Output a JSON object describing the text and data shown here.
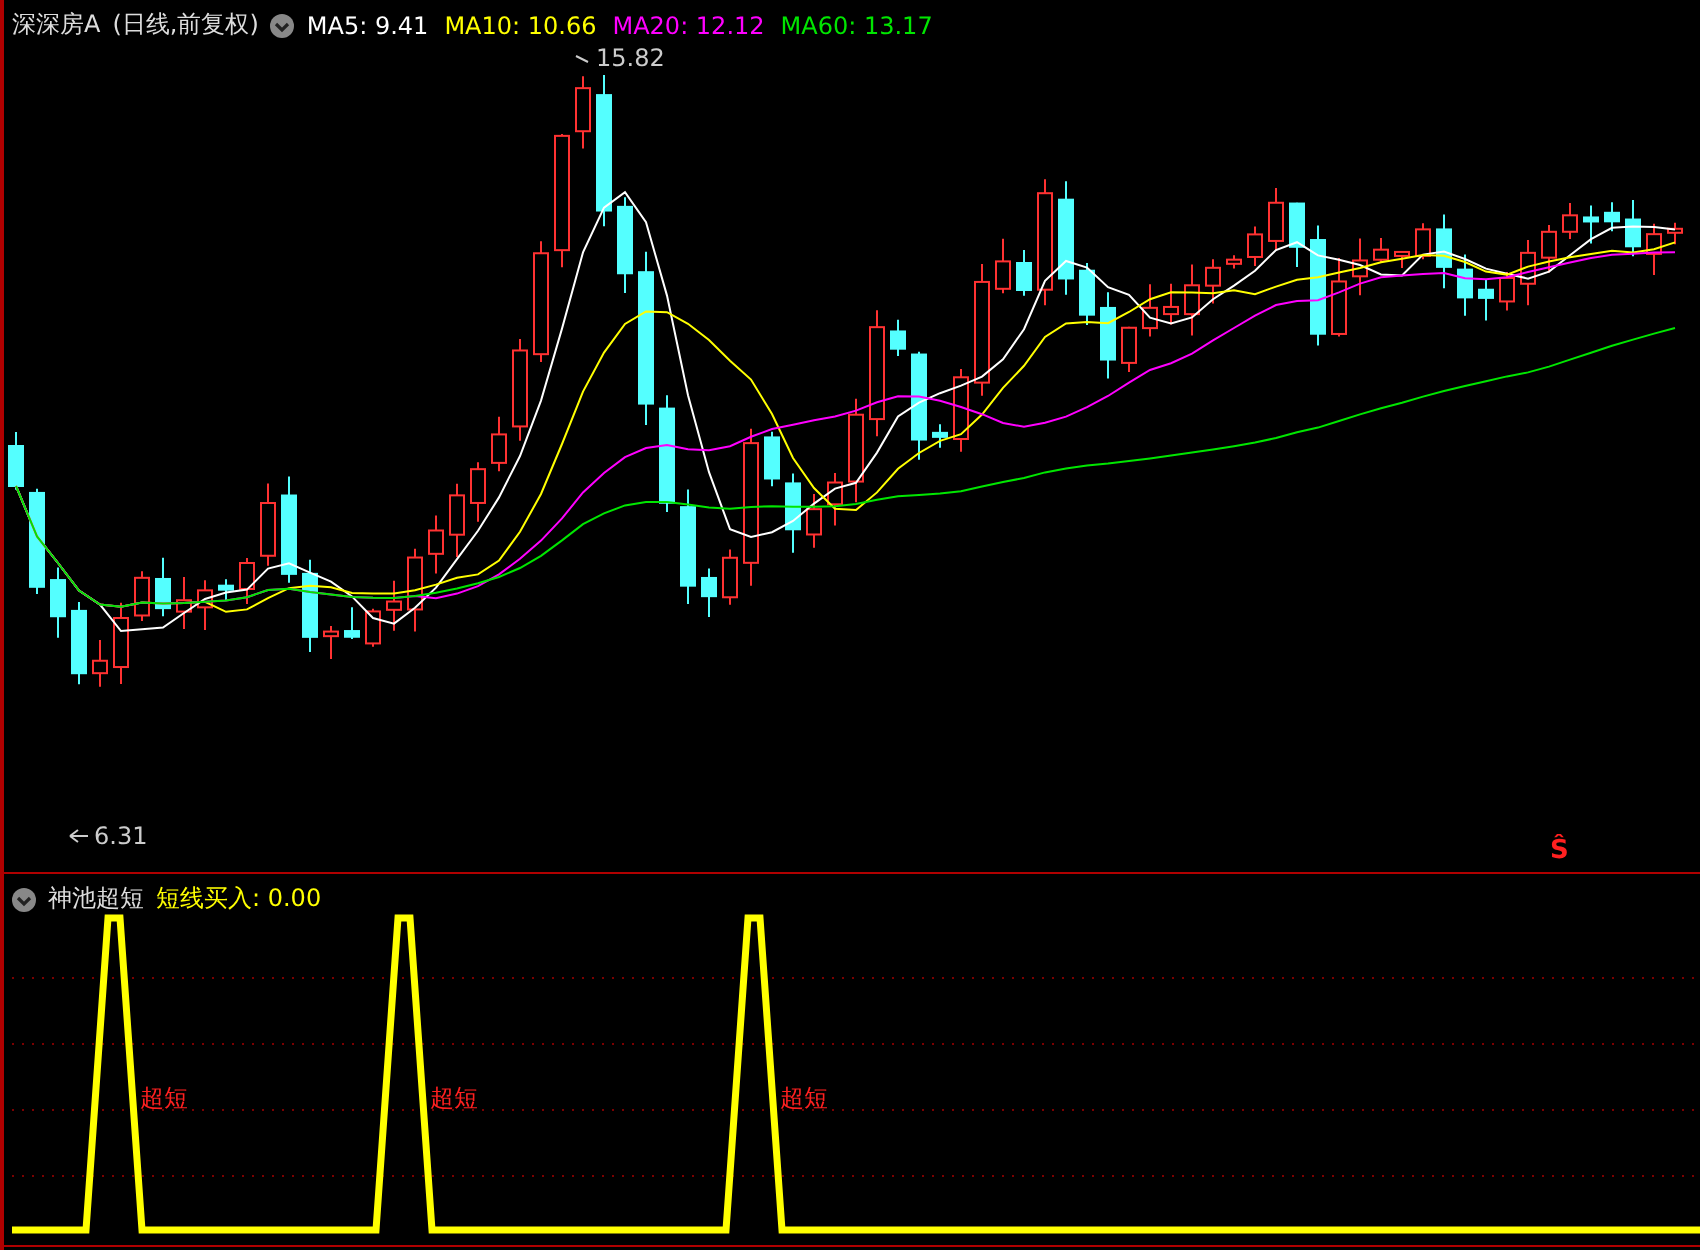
{
  "main_chart": {
    "title": "深深房A",
    "subtitle": "(日线,前复权)",
    "ma_legend": [
      {
        "label": "MA5: 9.41",
        "color": "#ffffff"
      },
      {
        "label": "MA10: 10.66",
        "color": "#ffff00"
      },
      {
        "label": "MA20: 12.12",
        "color": "#ff00ff"
      },
      {
        "label": "MA60: 13.17",
        "color": "#00e600"
      }
    ],
    "high_label": "15.82",
    "low_label": "6.31",
    "signal_marker": "Ŝ"
  },
  "indicator_panel": {
    "title": "神池超短",
    "legend": "短线买入: 0.00",
    "signal_labels": [
      "超短",
      "超短",
      "超短"
    ]
  }
}
